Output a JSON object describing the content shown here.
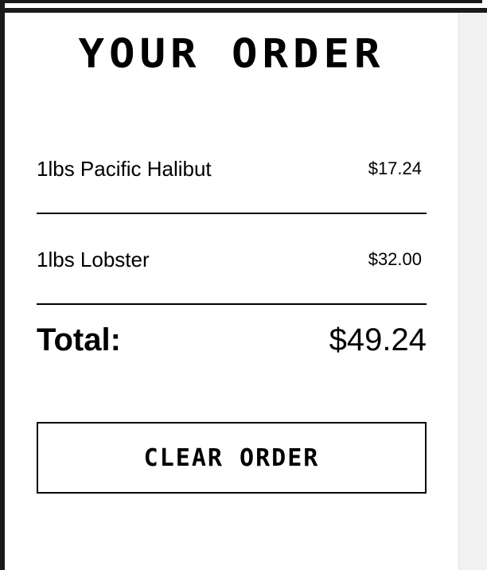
{
  "order": {
    "title": "YOUR ORDER",
    "items": [
      {
        "name": "1lbs Pacific Halibut",
        "price": "$17.24"
      },
      {
        "name": "1lbs Lobster",
        "price": "$32.00"
      }
    ],
    "total_label": "Total:",
    "total_value": "$49.24",
    "clear_button_label": "CLEAR ORDER"
  }
}
